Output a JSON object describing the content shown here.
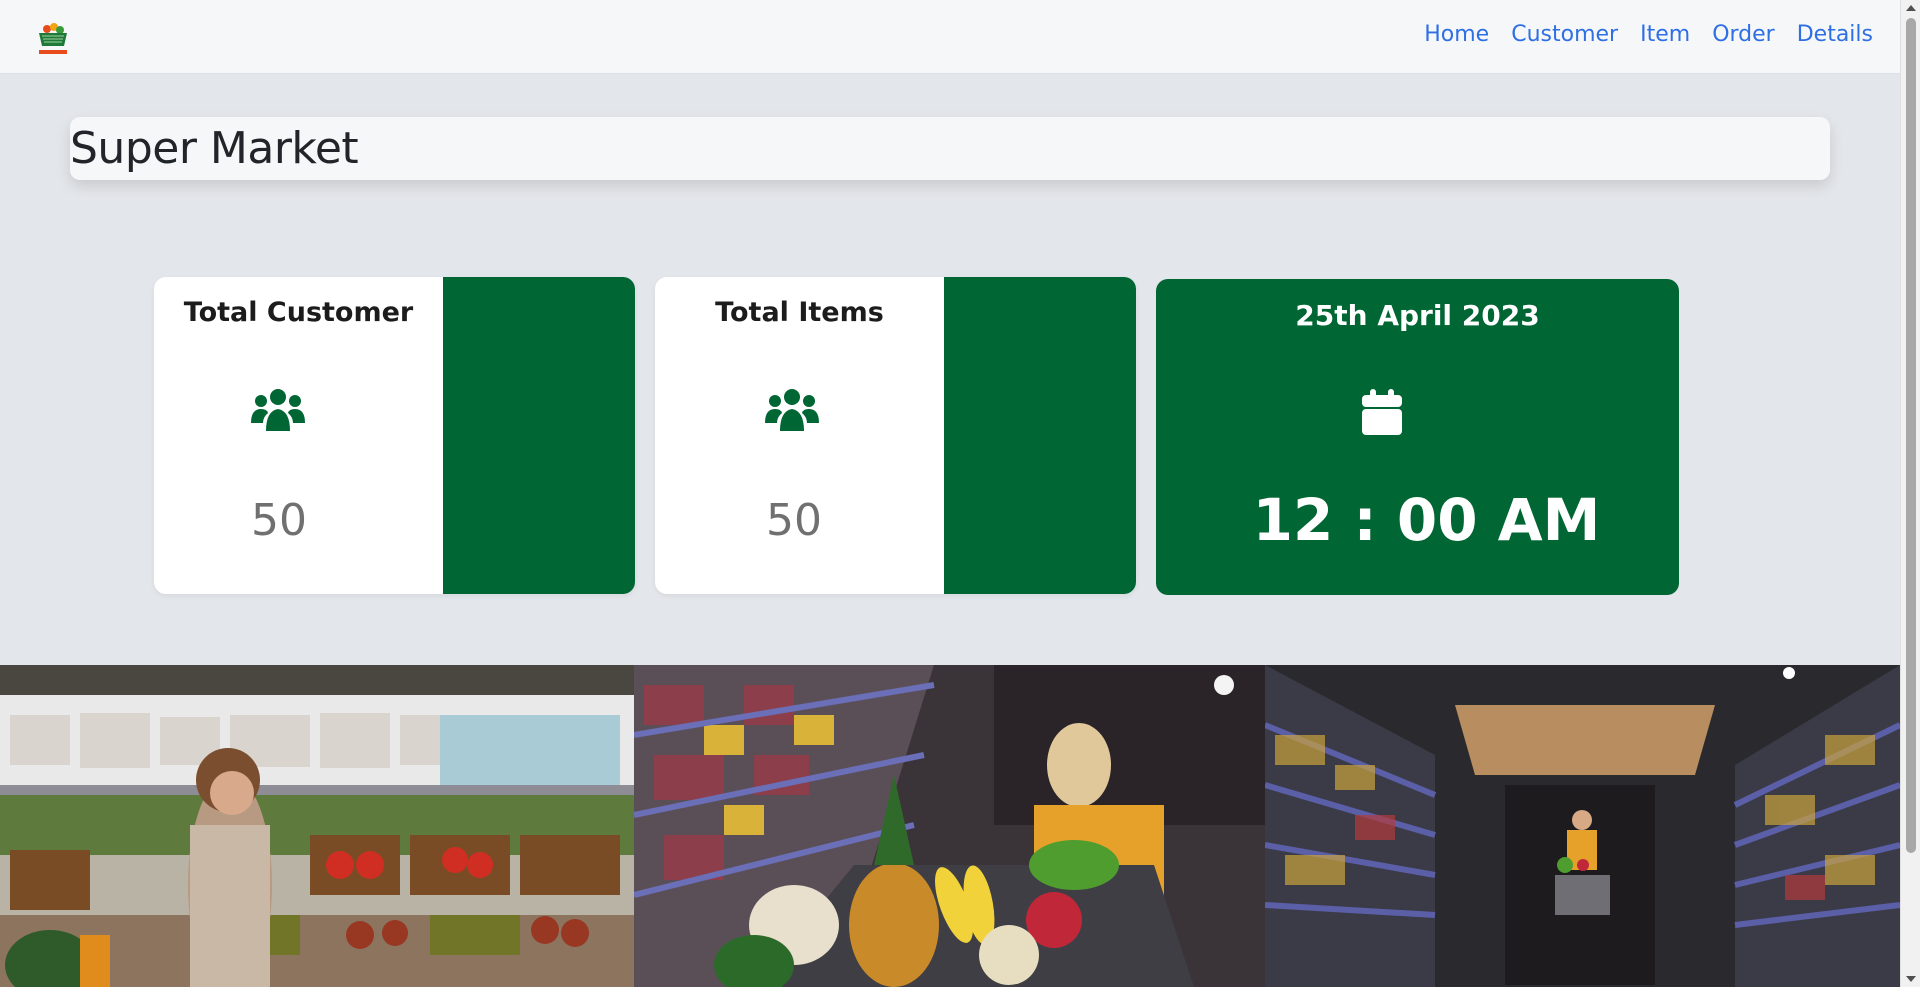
{
  "navbar": {
    "logo_text": "SUPERMARKET",
    "links": [
      {
        "label": "Home"
      },
      {
        "label": "Customer"
      },
      {
        "label": "Item"
      },
      {
        "label": "Order"
      },
      {
        "label": "Details"
      }
    ]
  },
  "header": {
    "title": "Super Market"
  },
  "stats": {
    "customers": {
      "label": "Total Customer",
      "value": "50",
      "icon": "users-icon"
    },
    "items": {
      "label": "Total Items",
      "value": "50",
      "icon": "users-icon"
    }
  },
  "datetime": {
    "date": "25th April 2023",
    "time": "12 : 00 AM",
    "icon": "calendar-icon"
  },
  "photos": [
    {
      "name": "woman-shopping-produce-photo"
    },
    {
      "name": "shopping-cart-fruits-photo"
    },
    {
      "name": "supermarket-aisle-photo"
    }
  ],
  "colors": {
    "brand_green": "#006633",
    "link_blue": "#2f6fe4",
    "page_bg": "#e3e6ea"
  }
}
